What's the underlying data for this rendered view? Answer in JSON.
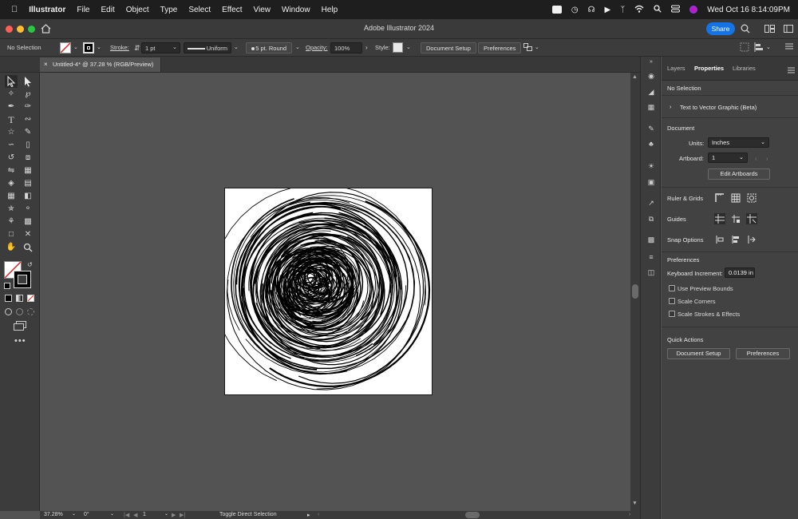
{
  "menubar": {
    "app_name": "Illustrator",
    "items": [
      "File",
      "Edit",
      "Object",
      "Type",
      "Select",
      "Effect",
      "View",
      "Window",
      "Help"
    ],
    "datetime": "Wed Oct 16  8:14:09PM"
  },
  "window": {
    "title": "Adobe Illustrator 2024",
    "share_label": "Share"
  },
  "control_bar": {
    "selection": "No Selection",
    "stroke_label": "Stroke:",
    "stroke_weight": "1 pt",
    "profile": "Uniform",
    "brush": "5 pt. Round",
    "opacity_label": "Opacity:",
    "opacity_value": "100%",
    "style_label": "Style:",
    "document_setup": "Document Setup",
    "preferences": "Preferences"
  },
  "document_tab": {
    "title": "Untitled-4* @ 37.28 % (RGB/Preview)"
  },
  "status_bar": {
    "zoom": "37.28%",
    "rotation": "0°",
    "artboard_number": "1",
    "status_text": "Toggle Direct Selection"
  },
  "panel": {
    "tabs": [
      "Layers",
      "Properties",
      "Libraries"
    ],
    "active_tab": "Properties",
    "selection": "No Selection",
    "text_to_vector": "Text to Vector Graphic (Beta)",
    "document_heading": "Document",
    "units_label": "Units:",
    "units_value": "Inches",
    "artboard_label": "Artboard:",
    "artboard_value": "1",
    "edit_artboards": "Edit Artboards",
    "ruler_grids": "Ruler & Grids",
    "guides": "Guides",
    "snap_options": "Snap Options",
    "preferences_heading": "Preferences",
    "keyboard_increment_label": "Keyboard Increment:",
    "keyboard_increment_value": "0.0139 in",
    "checkboxes": [
      "Use Preview Bounds",
      "Scale Corners",
      "Scale Strokes & Effects"
    ],
    "quick_actions_heading": "Quick Actions",
    "qa_document_setup": "Document Setup",
    "qa_preferences": "Preferences"
  },
  "colors": {
    "accent": "#1473e6",
    "canvas_bg": "#535353",
    "artboard": "#ffffff",
    "close": "#ff5f57",
    "minimize": "#febc2e",
    "zoom": "#28c840"
  }
}
